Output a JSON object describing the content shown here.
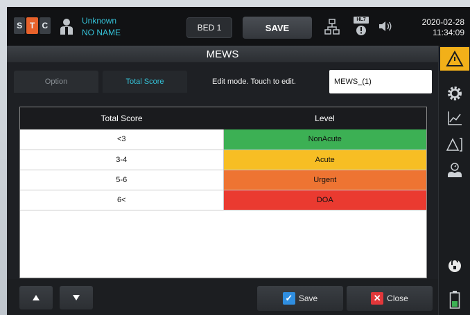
{
  "header": {
    "logo_letters": [
      "S",
      "T",
      "C"
    ],
    "patient_line1": "Unknown",
    "patient_line2": "NO NAME",
    "bed_label": "BED 1",
    "save_label": "SAVE",
    "hl7_label": "HL7",
    "date": "2020-02-28",
    "time": "11:34:09"
  },
  "title": "MEWS",
  "tabs": {
    "option": "Option",
    "total_score": "Total Score"
  },
  "edit_hint": "Edit mode. Touch to edit.",
  "mews_field": {
    "value": "MEWS_(1)"
  },
  "table": {
    "headers": [
      "Total Score",
      "Level"
    ],
    "rows": [
      {
        "score": "<3",
        "level": "NonAcute",
        "color": "#3cb054"
      },
      {
        "score": "3-4",
        "level": "Acute",
        "color": "#f7be24"
      },
      {
        "score": "5-6",
        "level": "Urgent",
        "color": "#ee7432"
      },
      {
        "score": "6<",
        "level": "DOA",
        "color": "#ea3a30"
      }
    ]
  },
  "buttons": {
    "save": "Save",
    "close": "Close"
  },
  "colors": {
    "accent": "#35c3d9",
    "active_tab": "#f2b019",
    "save_check": "#2f8ee0",
    "close_x": "#e2373a"
  },
  "sidebar_icons": [
    "alarm-triangle-icon",
    "gear-icon",
    "trend-chart-icon",
    "alarm-limits-icon",
    "patient-setup-icon",
    "lock-icon",
    "battery-icon"
  ]
}
